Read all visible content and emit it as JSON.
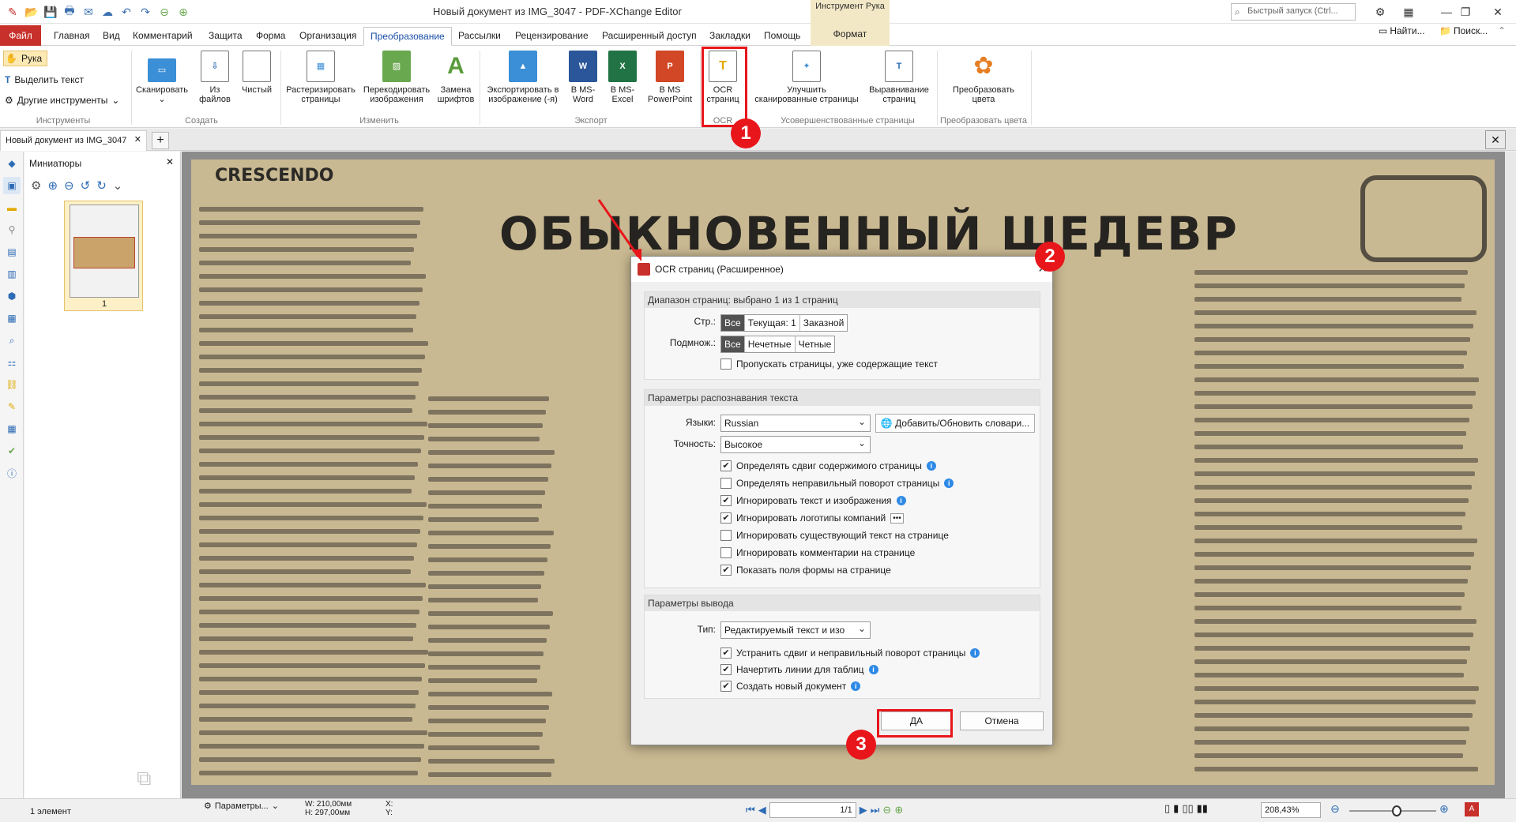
{
  "window": {
    "title": "Новый документ из IMG_3047 - PDF-XChange Editor",
    "context_tool": "Инструмент Рука",
    "quick_launch": "Быстрый запуск (Ctrl..."
  },
  "tabs": [
    "Файл",
    "Главная",
    "Вид",
    "Комментарий",
    "Защита",
    "Форма",
    "Организация",
    "Преобразование",
    "Рассылки",
    "Рецензирование",
    "Расширенный доступ",
    "Закладки",
    "Помощь",
    "Формат"
  ],
  "tabs_right": {
    "find": "Найти...",
    "search": "Поиск..."
  },
  "ribbon": {
    "tools": {
      "hand": "Рука",
      "select_text": "Выделить текст",
      "other_tools": "Другие инструменты",
      "group": "Инструменты"
    },
    "create": {
      "scan": "Сканировать",
      "from_files_1": "Из",
      "from_files_2": "файлов",
      "blank": "Чистый",
      "group": "Создать"
    },
    "modify": {
      "rasterize_1": "Растеризировать",
      "rasterize_2": "страницы",
      "reencode_1": "Перекодировать",
      "reencode_2": "изображения",
      "fonts_1": "Замена",
      "fonts_2": "шрифтов",
      "group": "Изменить"
    },
    "export": {
      "img_1": "Экспортировать в",
      "img_2": "изображение (-я)",
      "word_1": "В MS-",
      "word_2": "Word",
      "excel_1": "В MS-",
      "excel_2": "Excel",
      "ppt_1": "В MS",
      "ppt_2": "PowerPoint",
      "group": "Экспорт"
    },
    "ocr": {
      "l1": "OCR",
      "l2": "страниц",
      "group": "OCR"
    },
    "enhance": {
      "improve_1": "Улучшить",
      "improve_2": "сканированные страницы",
      "deskew_1": "Выравнивание",
      "deskew_2": "страниц",
      "group": "Усовершенствованные страницы"
    },
    "colors": {
      "l1": "Преобразовать",
      "l2": "цвета",
      "group": "Преобразовать цвета"
    }
  },
  "doc_tab": "Новый документ из IMG_3047",
  "thumb": {
    "title": "Миниатюры",
    "page": "1"
  },
  "scan": {
    "crescendo": "CRESCENDO",
    "headline": "ОБЫКНОВЕННЫЙ ШЕДЕВР"
  },
  "dialog": {
    "title": "OCR страниц (Расширенное)",
    "range_header": "Диапазон страниц: выбрано 1 из 1 страниц",
    "pages_label": "Стр.:",
    "pages_opts": [
      "Все",
      "Текущая: 1",
      "Заказной"
    ],
    "subset_label": "Подмнож.:",
    "subset_opts": [
      "Все",
      "Нечетные",
      "Четные"
    ],
    "skip_text": "Пропускать страницы, уже содержащие текст",
    "recog_header": "Параметры распознавания текста",
    "lang_label": "Языки:",
    "lang_value": "Russian",
    "dict_button": "Добавить/Обновить словари...",
    "accuracy_label": "Точность:",
    "accuracy_value": "Высокое",
    "options": [
      {
        "label": "Определять сдвиг содержимого страницы",
        "checked": true
      },
      {
        "label": "Определять неправильный поворот страницы",
        "checked": false
      },
      {
        "label": "Игнорировать текст и изображения",
        "checked": true
      },
      {
        "label": "Игнорировать логотипы компаний",
        "checked": true
      },
      {
        "label": "Игнорировать существующий текст на странице",
        "checked": false
      },
      {
        "label": "Игнорировать комментарии на странице",
        "checked": false
      },
      {
        "label": "Показать поля формы на странице",
        "checked": true
      }
    ],
    "output_header": "Параметры вывода",
    "type_label": "Тип:",
    "type_value": "Редактируемый текст и изо",
    "out_options": [
      {
        "label": "Устранить сдвиг и неправильный поворот страницы",
        "checked": true
      },
      {
        "label": "Начертить линии для таблиц",
        "checked": true
      },
      {
        "label": "Создать новый документ",
        "checked": true
      }
    ],
    "ok": "ДА",
    "cancel": "Отмена"
  },
  "badges": [
    "1",
    "2",
    "3"
  ],
  "status": {
    "count": "1 элемент",
    "params": "Параметры...",
    "w": "W: 210,00мм",
    "h": "H: 297,00мм",
    "x": "X:",
    "y": "Y:",
    "page": "1/1",
    "zoom": "208,43%"
  },
  "colors": {
    "accent": "#c8302b",
    "highlight": "#e8161b",
    "active_tab": "#1a4ea8"
  }
}
